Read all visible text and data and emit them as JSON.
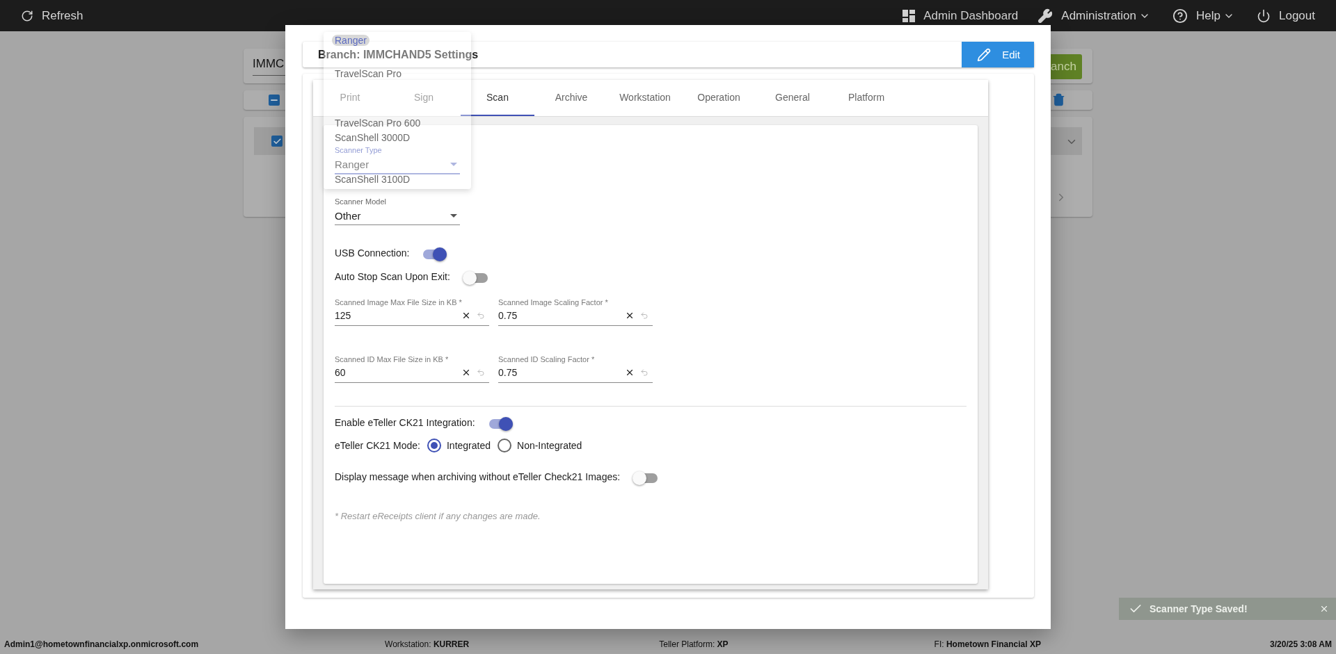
{
  "top_bar": {
    "refresh": "Refresh",
    "items": [
      {
        "kind": "dashboard",
        "label": "Admin Dashboard",
        "has_menu": false
      },
      {
        "kind": "wrench",
        "label": "Administration",
        "has_menu": true
      },
      {
        "kind": "help",
        "label": "Help",
        "has_menu": true
      },
      {
        "kind": "power",
        "label": "Logout",
        "has_menu": false
      }
    ]
  },
  "background": {
    "branch_value": "IMMC",
    "search_button": "anch",
    "header_checkbox": {
      "indeterminate": true
    },
    "row_checkbox": {
      "checked": true
    }
  },
  "settings": {
    "title": "Branch: IMMCHAND5 Settings",
    "edit_button": "Edit",
    "tabs": [
      {
        "label": "Print",
        "selected": false
      },
      {
        "label": "Sign",
        "selected": false
      },
      {
        "label": "Scan",
        "selected": true
      },
      {
        "label": "Archive",
        "selected": false
      },
      {
        "label": "Workstation",
        "selected": false
      },
      {
        "label": "Operation",
        "selected": false
      },
      {
        "label": "General",
        "selected": false
      },
      {
        "label": "Platform",
        "selected": false
      }
    ],
    "fields": [
      {
        "kind": "select",
        "label": "Scanner Type",
        "value": "Ranger",
        "focused": true
      },
      {
        "kind": "select",
        "label": "Scanner Model",
        "value": "Other",
        "focused": false
      },
      {
        "kind": "toggle",
        "label": "USB Connection:",
        "on": true
      },
      {
        "kind": "toggle",
        "label": "Auto Stop Scan Upon Exit:",
        "on": false
      },
      {
        "kind": "inputs",
        "inputs": [
          {
            "label": "Scanned Image Max File Size in KB *",
            "value": "125"
          },
          {
            "label": "Scanned Image Scaling Factor *",
            "value": "0.75"
          }
        ]
      },
      {
        "kind": "inputs",
        "inputs": [
          {
            "label": "Scanned ID Max File Size in KB *",
            "value": "60"
          },
          {
            "label": "Scanned ID Scaling Factor *",
            "value": "0.75"
          }
        ]
      },
      {
        "kind": "divider"
      },
      {
        "kind": "toggle",
        "label": "Enable eTeller CK21 Integration:",
        "on": true
      },
      {
        "kind": "radio",
        "label": "eTeller CK21 Mode:",
        "options": [
          {
            "label": "Integrated",
            "selected": true
          },
          {
            "label": "Non-Integrated",
            "selected": false
          }
        ]
      },
      {
        "kind": "toggle",
        "label": "Display message when archiving without eTeller Check21 Images:",
        "on": false
      },
      {
        "kind": "note",
        "text": "* Restart eReceipts client if any changes are made."
      }
    ]
  },
  "dropdown": {
    "options": [
      {
        "label": "Ranger",
        "selected": true
      },
      {
        "label": "TravelScan Pro",
        "selected": false
      },
      {
        "label": "TravelScan Pro 600",
        "selected": false
      },
      {
        "label": "ScanShell 3000D",
        "selected": false
      },
      {
        "label": "ScanShell 3100D",
        "selected": false
      }
    ]
  },
  "toast": {
    "message": "Scanner Type Saved!"
  },
  "status_bar": {
    "user": "Admin1@hometownfinancialxp.onmicrosoft.com",
    "items": [
      {
        "label": "Workstation:",
        "value": "KURRER"
      },
      {
        "label": "Teller Platform:",
        "value": "XP"
      },
      {
        "label": "FI:",
        "value": "Hometown Financial XP"
      }
    ],
    "datetime": "3/20/25 3:08 AM"
  }
}
